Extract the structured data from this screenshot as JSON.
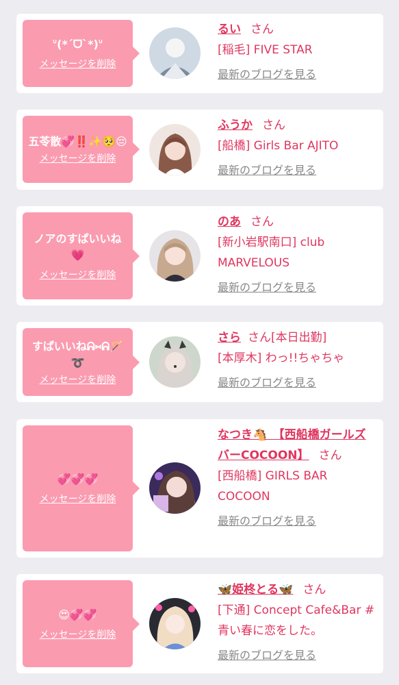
{
  "delete_label": "メッセージを削除",
  "blog_label": "最新のブログを見る",
  "honorific": "さん",
  "items": [
    {
      "message": "ᐡ(*ˊᗜˋ*)ᐡ",
      "name": "るい",
      "shop": "[稲毛] FIVE STAR",
      "avatar": "avatar-rui"
    },
    {
      "message": "五苓散💞‼️✨🥺😔",
      "name": "ふうか",
      "shop": "[船橋] Girls Bar AJITO",
      "avatar": "avatar-fuuka"
    },
    {
      "message": "ノアのすぱいいね💗",
      "name": "のあ",
      "shop": "[新小岩駅南口] club MARVELOUS",
      "avatar": "avatar-noa"
    },
    {
      "message": "すぱいいねᕱ⑅ᕱ🪄➰",
      "name": "さら",
      "name_suffix": "[本日出勤]",
      "shop": "[本厚木] わっ!!ちゃちゃ",
      "avatar": "avatar-sara"
    },
    {
      "message": "💞💞💞",
      "name": "なつき🐴　【西船橋ガールズバーCOCOON】",
      "shop": "[西船橋] GIRLS BAR COCOON",
      "avatar": "avatar-natsuki"
    },
    {
      "message": "😍💞💞",
      "name": "🦋姫柊とる🦋",
      "shop": "[下通] Concept Cafe&Bar #青い春に恋をした。",
      "avatar": "avatar-toru"
    }
  ],
  "colors": {
    "bubble": "#fb9bb0",
    "accent": "#e0365f",
    "link_gray": "#888888",
    "background": "#ededf1"
  }
}
